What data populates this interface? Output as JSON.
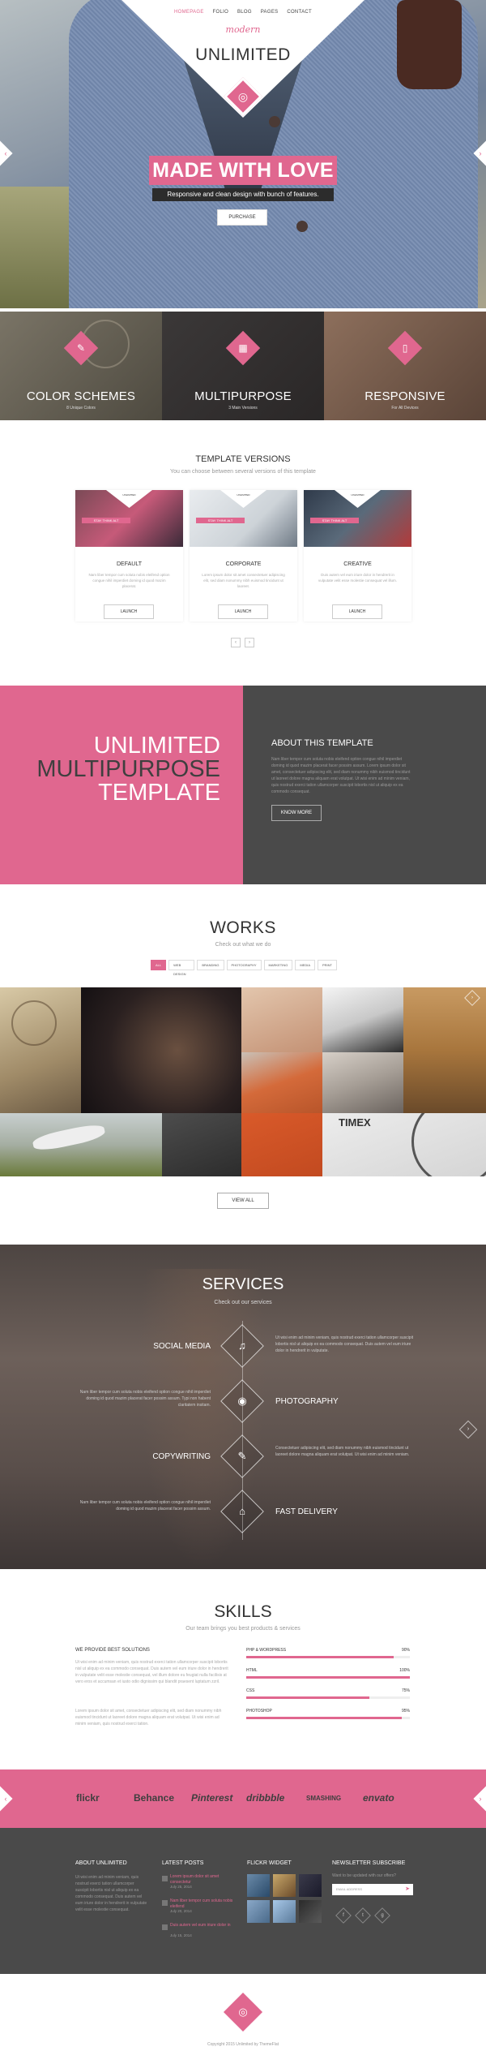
{
  "nav": {
    "items": [
      "HOMEPAGE",
      "FOLIO",
      "BLOG",
      "PAGES",
      "CONTACT"
    ]
  },
  "brand": {
    "script": "modern",
    "title": "UNLIMITED"
  },
  "hero": {
    "headline": "MADE WITH LOVE",
    "subline": "Responsive and clean design with bunch of features.",
    "button": "PURCHASE"
  },
  "features": [
    {
      "title": "COLOR SCHEMES",
      "sub": "8 Unique Colors",
      "icon": "brush-icon"
    },
    {
      "title": "MULTIPURPOSE",
      "sub": "3 Main Versions",
      "icon": "grid-icon"
    },
    {
      "title": "RESPONSIVE",
      "sub": "For All Devices",
      "icon": "phone-icon"
    }
  ],
  "template_versions": {
    "title": "TEMPLATE VERSIONS",
    "subtitle": "You can choose between several versions of this template",
    "cards": [
      {
        "name": "DEFAULT",
        "desc": "Nam liber tempor cum soluta nobis eleifend option congue nihil imperdiet doming id quod mazim placerat.",
        "button": "LAUNCH",
        "thumb_text": "STAY THINK ALT",
        "thumb_logo": "UNLIMITED"
      },
      {
        "name": "CORPORATE",
        "desc": "Lorem ipsum dolor sit amet consectetuer adipiscing elit, sed diam nonummy nibh euismod tincidunt ut laoreet.",
        "button": "LAUNCH",
        "thumb_text": "STAY THINK ALT",
        "thumb_logo": "UNLIMITED"
      },
      {
        "name": "CREATIVE",
        "desc": "Duis autem vel eum iriure dolor in hendrerit in vulputate velit esse molestie consequat vel illum.",
        "button": "LAUNCH",
        "thumb_text": "STAY THINK ALT",
        "thumb_logo": "UNLIMITED"
      }
    ],
    "pager": [
      "‹",
      "›"
    ]
  },
  "unlimited": {
    "line1": "UNLIMITED",
    "line2": "MULTIPURPOSE",
    "line3": "TEMPLATE",
    "about_title": "ABOUT THIS TEMPLATE",
    "about_text": "Nam liber tempor cum soluta nobis eleifend option congue nihil imperdiet doming id quod mazim placerat facer possim assum. Lorem ipsum dolor sit amet, consectetuer adipiscing elit, sed diam nonummy nibh euismod tincidunt ut laoreet dolore magna aliquam erat volutpat. Ut wisi enim ad minim veniam, quis nostrud exerci tation ullamcorper suscipit lobortis nisl ut aliquip ex ea commodo consequat.",
    "about_button": "KNOW MORE"
  },
  "works": {
    "title": "WORKS",
    "subtitle": "Check out what we do",
    "filters": [
      "ALL",
      "WEB DESIGN",
      "BRANDING",
      "PHOTOGRAPHY",
      "MARKETING",
      "MEDIA",
      "PRINT"
    ],
    "button": "VIEW ALL"
  },
  "services": {
    "title": "SERVICES",
    "subtitle": "Check out our services",
    "items": [
      {
        "name": "SOCIAL MEDIA",
        "icon": "microphone-icon",
        "text": "Ut wisi enim ad minim veniam, quis nostrud exerci tation ullamcorper suscipit lobortis nisl ut aliquip ex ea commodo consequat. Duis autem vel eum iriure dolor in hendrerit in vulputate."
      },
      {
        "name": "PHOTOGRAPHY",
        "icon": "camera-icon",
        "text": "Nam liber tempor cum soluta nobis eleifend option congue nihil imperdiet doming id quod mazim placerat facer possim assum. Typi non habent claritatem insitam."
      },
      {
        "name": "COPYWRITING",
        "icon": "pencil-icon",
        "text": "Consectetuer adipiscing elit, sed diam nonummy nibh euismod tincidunt ut laoreet dolore magna aliquam erat volutpat. Ut wisi enim ad minim veniam."
      },
      {
        "name": "FAST DELIVERY",
        "icon": "gift-icon",
        "text": "Nam liber tempor cum soluta nobis eleifend option congue nihil imperdiet doming id quod mazim placerat facer possim assum."
      }
    ]
  },
  "skills": {
    "title": "SKILLS",
    "subtitle": "Our team brings you best products & services",
    "heading": "WE PROVIDE BEST SOLUTIONS",
    "p1": "Ut wisi enim ad minim veniam, quis nostrud exerci tation ullamcorper suscipit lobortis nisl ut aliquip ex ea commodo consequat. Duis autem vel eum iriure dolor in hendrerit in vulputate velit esse molestie consequat, vel illum dolore eu feugiat nulla facilisis at vero eros et accumsan et iusto odio dignissim qui blandit praesent luptatum zzril.",
    "p2": "Lorem ipsum dolor sit amet, consectetuer adipiscing elit, sed diam nonummy nibh euismod tincidunt ut laoreet dolore magna aliquam erat volutpat. Ut wisi enim ad minim veniam, quis nostrud exerci tation.",
    "bars": [
      {
        "label": "PHP & WORDPRESS",
        "pct": "90%",
        "value": 0.9
      },
      {
        "label": "HTML",
        "pct": "100%",
        "value": 1.0
      },
      {
        "label": "CSS",
        "pct": "75%",
        "value": 0.75
      },
      {
        "label": "PHOTOSHOP",
        "pct": "95%",
        "value": 0.95
      }
    ]
  },
  "clients": [
    "flickr",
    "Behance",
    "Pinterest",
    "dribbble",
    "SMASHING",
    "envato"
  ],
  "footer": {
    "about_title": "ABOUT UNLIMITED",
    "about_text": "Ut wisi enim ad minim veniam, quis nostrud exerci tation ullamcorper suscipit lobortis nisl ut aliquip ex ea commodo consequat. Duis autem vel eum iriure dolor in hendrerit in vulputate velit esse molestie consequat.",
    "posts_title": "LATEST POSTS",
    "posts": [
      {
        "title": "Lorem ipsum dolor sit amet consectetur",
        "date": "July 25, 2014"
      },
      {
        "title": "Nam liber tempor cum soluta nobis eleifend",
        "date": "July 20, 2014"
      },
      {
        "title": "Duis autem vel eum iriure dolor in",
        "date": "July 15, 2014"
      }
    ],
    "flickr_title": "FLICKR WIDGET",
    "news_title": "NEWSLETTER SUBSCRIBE",
    "news_text": "Want to be updated with our offers?",
    "news_placeholder": "EMAIL ADDRESS",
    "social": [
      "f",
      "t",
      "g"
    ]
  },
  "copyright": "Copyright 2015 Unlimited by ThemeFlat"
}
